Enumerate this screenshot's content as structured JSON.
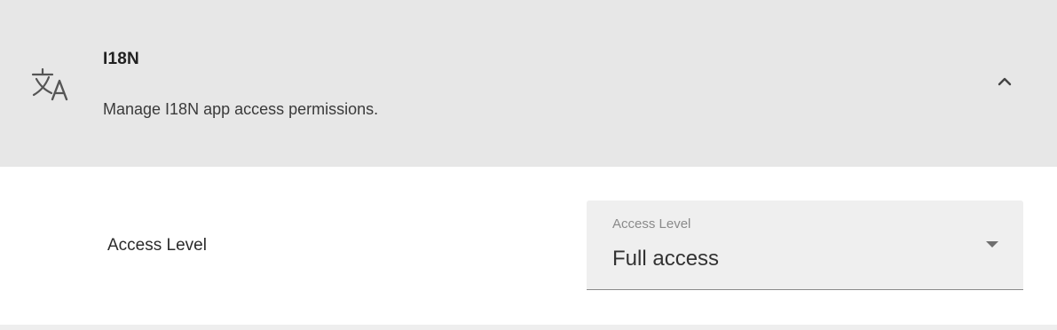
{
  "permission_panel": {
    "icon": "translate-icon",
    "title": "I18N",
    "description": "Manage I18N app access permissions.",
    "toggle_icon": "chevron-up-icon",
    "expanded": true
  },
  "access_setting": {
    "label": "Access Level",
    "select": {
      "floating_label": "Access Level",
      "value": "Full access",
      "arrow_icon": "dropdown-arrow-icon"
    }
  },
  "colors": {
    "header_background": "#e7e7e7",
    "select_background": "#efefef",
    "page_background": "#ffffff"
  }
}
